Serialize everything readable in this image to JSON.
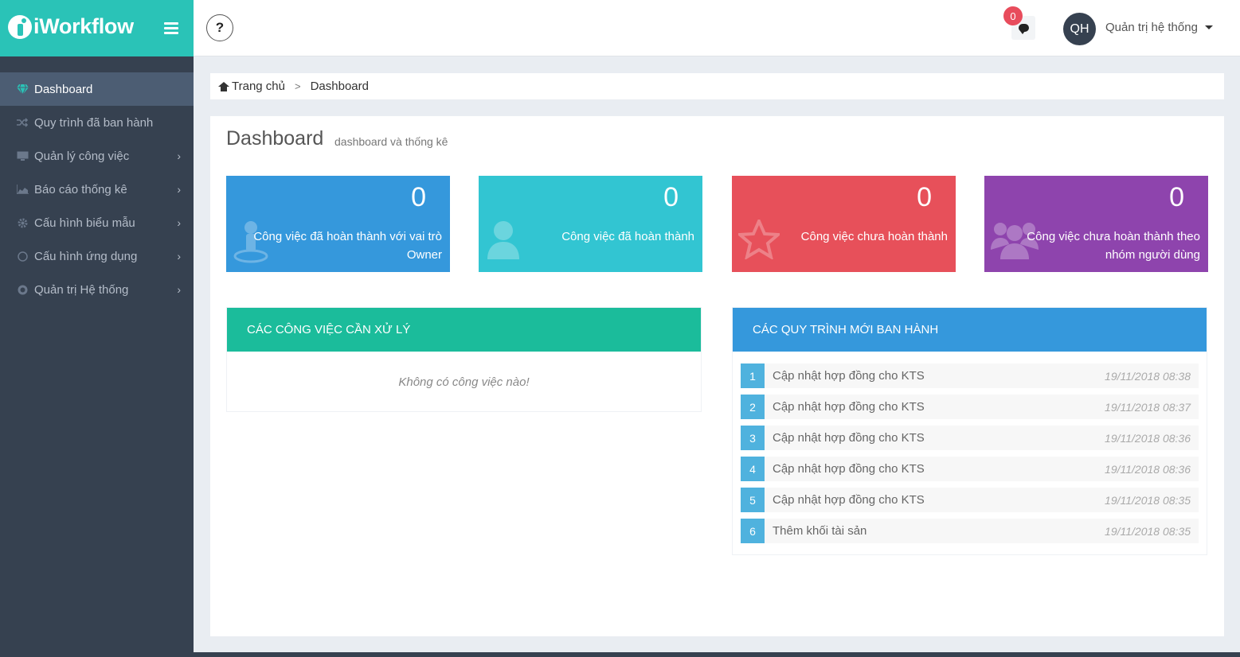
{
  "brand": {
    "name": "iWorkflow"
  },
  "sidebar": {
    "items": [
      {
        "label": "Dashboard",
        "icon": "diamond-icon"
      },
      {
        "label": "Quy trình đã ban hành",
        "icon": "shuffle-icon"
      },
      {
        "label": "Quản lý công việc",
        "icon": "monitor-icon"
      },
      {
        "label": "Báo cáo thống kê",
        "icon": "area-chart-icon"
      },
      {
        "label": "Cấu hình biểu mẫu",
        "icon": "gear-icon"
      },
      {
        "label": "Cấu hình ứng dụng",
        "icon": "circle-icon"
      },
      {
        "label": "Quản trị Hệ thống",
        "icon": "globe-icon"
      }
    ]
  },
  "header": {
    "help_label": "?",
    "notification_count": "0",
    "user_initials": "QH",
    "user_name": "Quản trị hệ thống"
  },
  "breadcrumb": {
    "home": "Trang chủ",
    "current": "Dashboard"
  },
  "page": {
    "title": "Dashboard",
    "subtitle": "dashboard và thống kê"
  },
  "stats": [
    {
      "value": "0",
      "label": "Công việc đã hoàn thành với vai trò Owner",
      "color": "#3598dc",
      "icon": "user-pin-icon"
    },
    {
      "value": "0",
      "label": "Công việc đã hoàn thành",
      "color": "#32c5d2",
      "icon": "user-icon"
    },
    {
      "value": "0",
      "label": "Công việc chưa hoàn thành",
      "color": "#e7505a",
      "icon": "star-icon"
    },
    {
      "value": "0",
      "label": "Công việc chưa hoàn thành theo nhóm người dùng",
      "color": "#8e44ad",
      "icon": "users-icon"
    }
  ],
  "tasks_panel": {
    "title": "CÁC CÔNG VIỆC CẦN XỬ LÝ",
    "empty_text": "Không có công việc nào!"
  },
  "processes_panel": {
    "title": "CÁC QUY TRÌNH MỚI BAN HÀNH",
    "items": [
      {
        "index": "1",
        "name": "Cập nhật hợp đồng cho KTS",
        "time": "19/11/2018 08:38"
      },
      {
        "index": "2",
        "name": "Cập nhật hợp đồng cho KTS",
        "time": "19/11/2018 08:37"
      },
      {
        "index": "3",
        "name": "Cập nhật hợp đồng cho KTS",
        "time": "19/11/2018 08:36"
      },
      {
        "index": "4",
        "name": "Cập nhật hợp đồng cho KTS",
        "time": "19/11/2018 08:36"
      },
      {
        "index": "5",
        "name": "Cập nhật hợp đồng cho KTS",
        "time": "19/11/2018 08:35"
      },
      {
        "index": "6",
        "name": "Thêm khối tài sản",
        "time": "19/11/2018 08:35"
      }
    ]
  }
}
